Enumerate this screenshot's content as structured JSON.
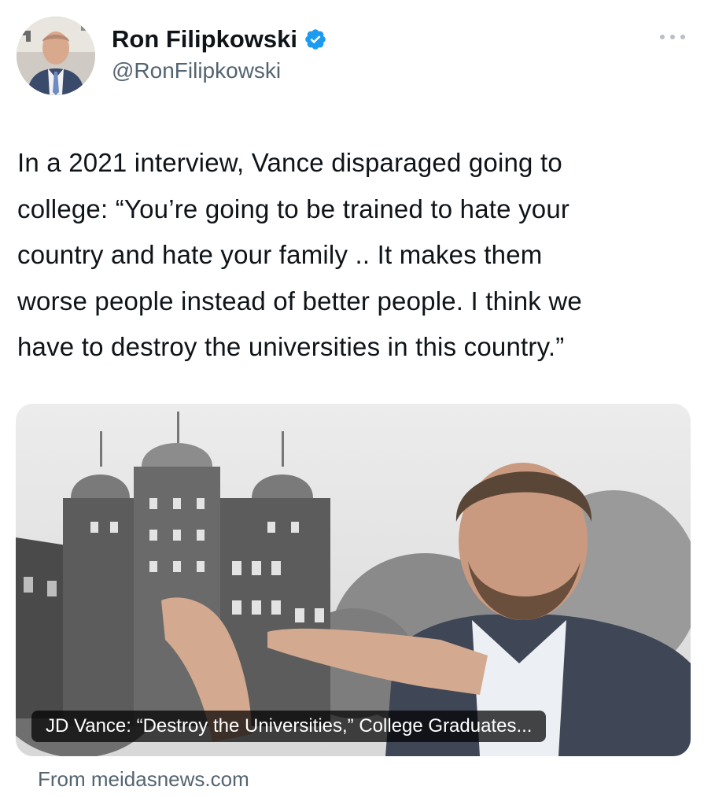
{
  "author": {
    "display_name": "Ron Filipkowski",
    "handle": "@RonFilipkowski",
    "verified": true,
    "avatar": "profile-photo"
  },
  "tweet": {
    "text_lines": [
      "In a 2021 interview, Vance disparaged going to",
      "college: “You’re going to be trained to hate your",
      "country and hate your family .. It makes them",
      "worse people instead of better people. I think we",
      "have to destroy the universities in this country.”"
    ]
  },
  "link_card": {
    "title": "JD Vance: “Destroy the Universities,” College Graduates...",
    "source": "From meidasnews.com"
  },
  "icons": {
    "verified": "verified-badge-icon",
    "more": "more-options-icon"
  },
  "colors": {
    "text": "#0f1419",
    "secondary": "#536471",
    "verified": "#1d9bf0"
  }
}
